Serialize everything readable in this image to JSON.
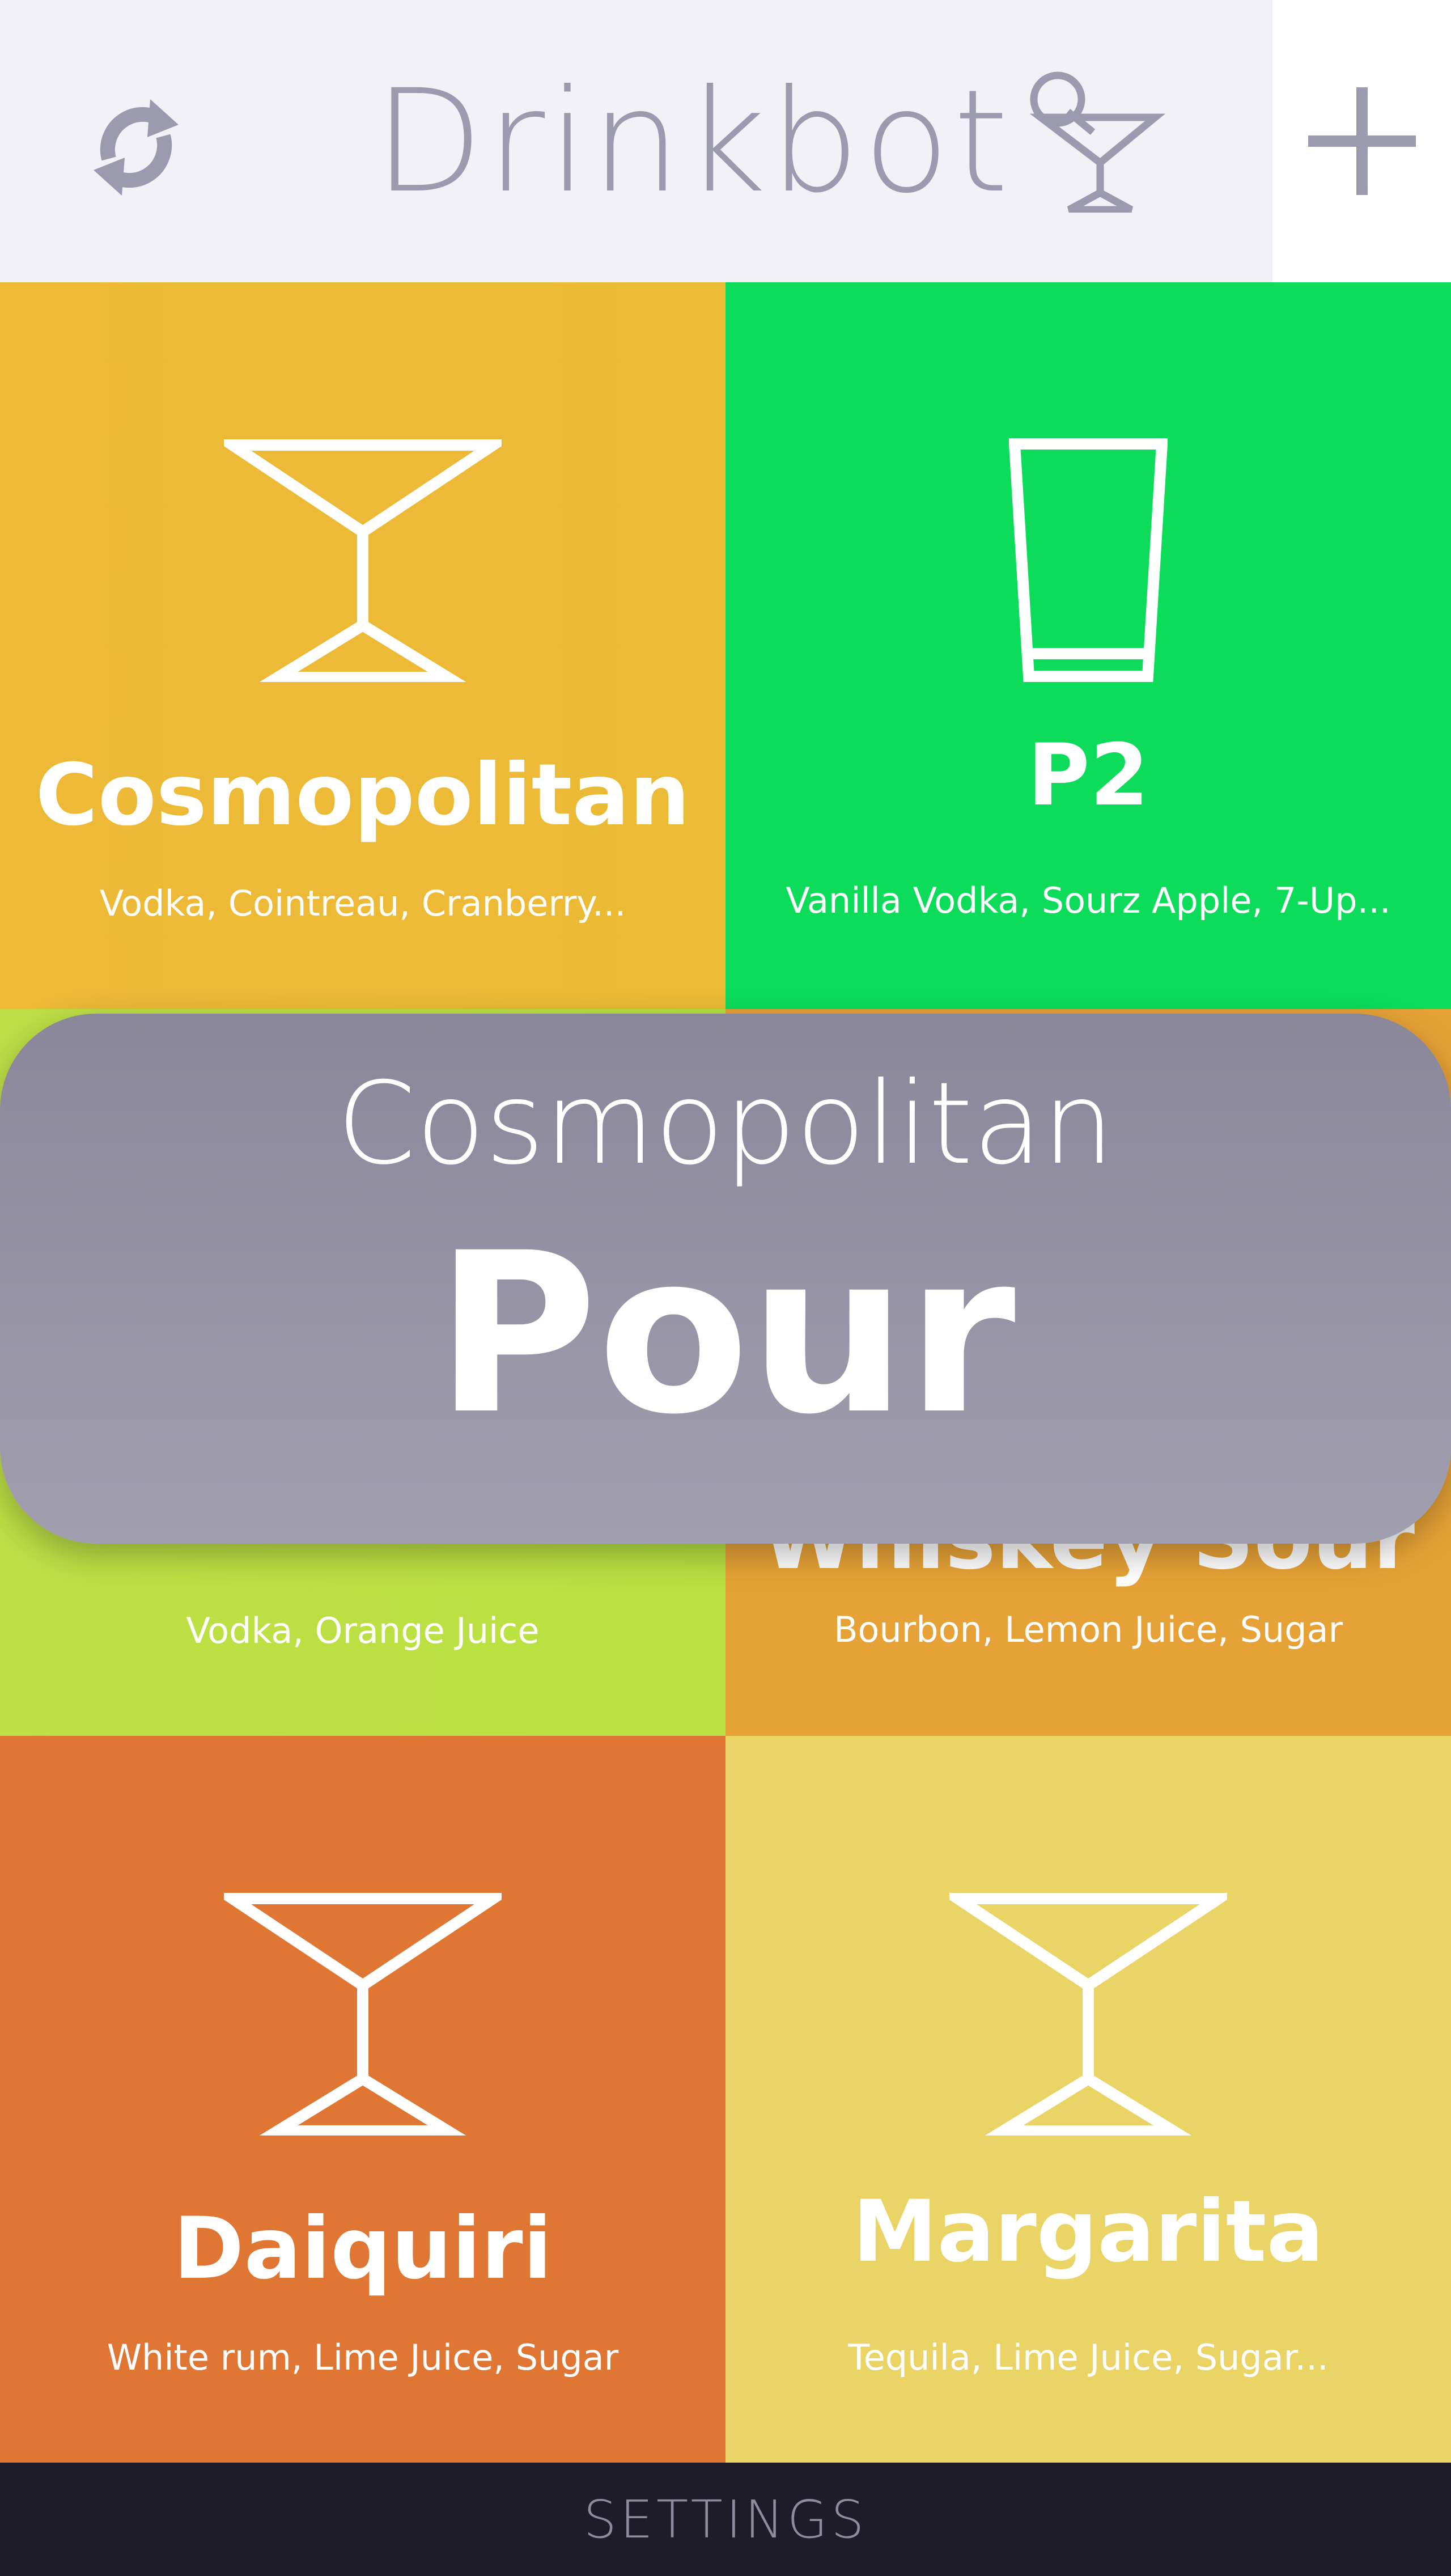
{
  "header": {
    "title": "Drinkbot",
    "refresh_icon": "refresh-icon",
    "add_icon": "plus-icon",
    "logo_icon": "cocktail-glass-icon",
    "text_color": "#9c9aae",
    "background": "#f2f1f7"
  },
  "drinks": [
    {
      "name": "Cosmopolitan",
      "ingredients": "Vodka, Cointreau, Cranberry...",
      "glass": "martini-glass-icon",
      "color": "#edb937"
    },
    {
      "name": "P2",
      "ingredients": "Vanilla Vodka, Sourz Apple, 7-Up...",
      "glass": "highball-glass-icon",
      "color": "#0cdc5a"
    },
    {
      "name": "",
      "ingredients": "Vodka, Orange Juice",
      "glass": "",
      "color": "#bde042"
    },
    {
      "name": "Whiskey Sour",
      "ingredients": "Bourbon, Lemon Juice, Sugar",
      "glass": "",
      "color": "#e6a236"
    },
    {
      "name": "Daiquiri",
      "ingredients": "White rum, Lime Juice, Sugar",
      "glass": "martini-glass-icon",
      "color": "#df7633"
    },
    {
      "name": "Margarita",
      "ingredients": "Tequila, Lime Juice, Sugar...",
      "glass": "martini-glass-icon",
      "color": "#e9d465"
    }
  ],
  "pour_dialog": {
    "drink_name": "Cosmopolitan",
    "button_label": "Pour"
  },
  "footer": {
    "label": "SETTINGS"
  }
}
